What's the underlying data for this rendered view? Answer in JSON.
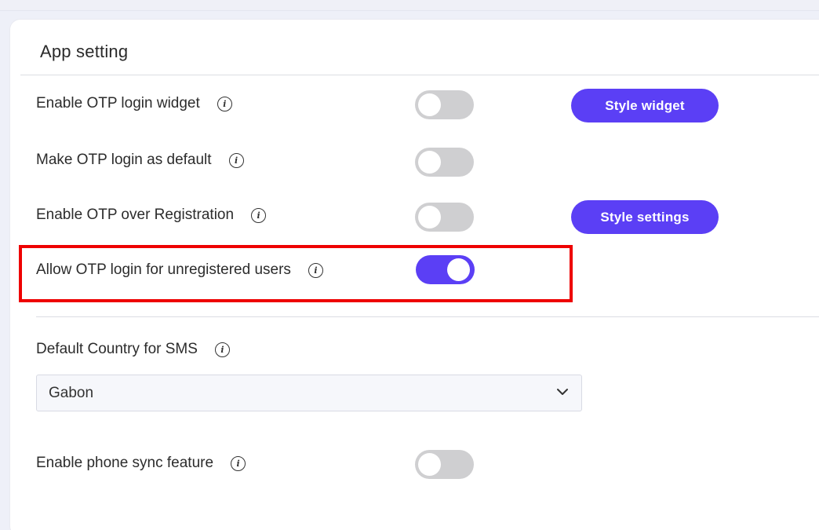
{
  "card": {
    "title": "App setting"
  },
  "settings": [
    {
      "label": "Enable OTP login widget",
      "enabled": false,
      "button": "Style widget"
    },
    {
      "label": "Make OTP login as default",
      "enabled": false
    },
    {
      "label": "Enable OTP over Registration",
      "enabled": false,
      "button": "Style settings"
    },
    {
      "label": "Allow OTP login for unregistered users",
      "enabled": true
    }
  ],
  "sms": {
    "label": "Default Country for SMS",
    "selected": "Gabon"
  },
  "phone_sync": {
    "label": "Enable phone sync feature",
    "enabled": false
  },
  "colors": {
    "accent": "#5b3ff5",
    "toggle_off": "#cfcfd1",
    "highlight": "#ee0000"
  },
  "icons": {
    "info": "info-icon",
    "dropdown": "chevron-down-icon"
  }
}
